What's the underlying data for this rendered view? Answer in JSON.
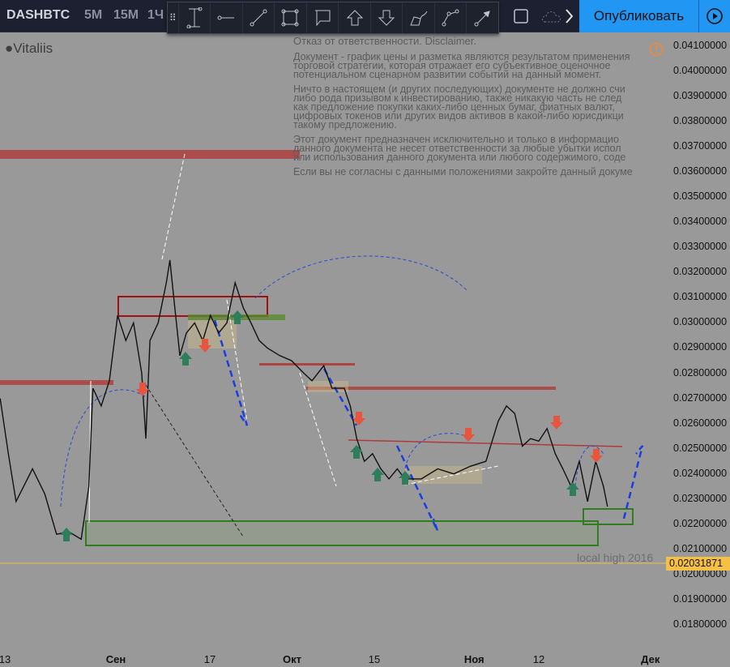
{
  "header": {
    "symbol": "DASHBTC",
    "intervals": [
      "5М",
      "15М",
      "1Ч"
    ],
    "publish_label": "Опубликовать"
  },
  "drawing_tools": [
    "cross-line-icon",
    "horizontal-ray-icon",
    "trend-line-icon",
    "rectangle-icon",
    "callout-icon",
    "arrow-up-icon",
    "arrow-down-icon",
    "brush-icon",
    "path-icon",
    "arrow-line-icon"
  ],
  "author": "Vitaliis",
  "disclaimer": {
    "title": "Отказ от ответственности. Disclaimer.",
    "p1": [
      "Документ - график цены и разметка являются результатом применения",
      "торговой стратегии, которая отражает его субъективное оценочное",
      "потенциальном сценарном развитии событий на данный момент."
    ],
    "p2": [
      "Ничто в настоящем (и других последующих) документе не должно счи",
      "либо рода призывом к инвестированию, также никакую часть не след",
      "как предложение покупки каких-либо ценных бумаг, фиатных валют,",
      "цифровых токенов или других видов активов в какой-либо юрисдикци",
      "такому предложению."
    ],
    "p3": [
      "Этот документ предназначен исключительно и только в информацио",
      "данного документа не несет ответственности за любые убытки испол",
      "или использования данного документа или любого содержимого, соде"
    ],
    "p4": "Если вы не согласны с данными положениями закройте данный докуме"
  },
  "colors": {
    "bg": "#999999",
    "publish": "#2196f3",
    "last_price": "#f5c044",
    "resistance": "#b03a3a",
    "support": "#3f8a2f",
    "forecast": "#1a3ee0"
  },
  "chart_data": {
    "type": "line",
    "title": "DASHBTC",
    "ylim": [
      0.0175,
      0.0415
    ],
    "yticks": [
      "0.04100000",
      "0.04000000",
      "0.03900000",
      "0.03800000",
      "0.03700000",
      "0.03600000",
      "0.03500000",
      "0.03400000",
      "0.03300000",
      "0.03200000",
      "0.03100000",
      "0.03000000",
      "0.02900000",
      "0.02800000",
      "0.02700000",
      "0.02600000",
      "0.02500000",
      "0.02400000",
      "0.02300000",
      "0.02200000",
      "0.02100000",
      "0.02000000",
      "0.01900000",
      "0.01800000"
    ],
    "xticks": [
      {
        "label": "13",
        "day": -19,
        "bold": false
      },
      {
        "label": "Сен",
        "day": 0,
        "bold": true
      },
      {
        "label": "17",
        "day": 16,
        "bold": false
      },
      {
        "label": "Окт",
        "day": 30,
        "bold": true
      },
      {
        "label": "15",
        "day": 44,
        "bold": false
      },
      {
        "label": "Ноя",
        "day": 61,
        "bold": true
      },
      {
        "label": "12",
        "day": 72,
        "bold": false
      },
      {
        "label": "Дек",
        "day": 91,
        "bold": true
      }
    ],
    "xunit": "days since Sep 1",
    "series": [
      {
        "name": "DASHBTC",
        "points": [
          [
            -19.7,
            0.027
          ],
          [
            -18.3,
            0.0248
          ],
          [
            -17,
            0.0229
          ],
          [
            -14.2,
            0.0242
          ],
          [
            -12.1,
            0.0232
          ],
          [
            -10.1,
            0.0216
          ],
          [
            -8,
            0.0217
          ],
          [
            -5.9,
            0.0214
          ],
          [
            -4.6,
            0.0235
          ],
          [
            -3.9,
            0.0274
          ],
          [
            -2.5,
            0.0267
          ],
          [
            -1.1,
            0.0277
          ],
          [
            0.3,
            0.0303
          ],
          [
            1.7,
            0.0293
          ],
          [
            3,
            0.03
          ],
          [
            4.4,
            0.028
          ],
          [
            5.1,
            0.0254
          ],
          [
            5.8,
            0.0293
          ],
          [
            7.2,
            0.03
          ],
          [
            8.6,
            0.0316
          ],
          [
            9.2,
            0.0325
          ],
          [
            9.9,
            0.0309
          ],
          [
            10.9,
            0.0287
          ],
          [
            12,
            0.0296
          ],
          [
            13.4,
            0.03
          ],
          [
            14.8,
            0.0293
          ],
          [
            16.1,
            0.0303
          ],
          [
            17.5,
            0.0296
          ],
          [
            18.9,
            0.03
          ],
          [
            20.3,
            0.0316
          ],
          [
            21.7,
            0.0306
          ],
          [
            23,
            0.03
          ],
          [
            24.4,
            0.0293
          ],
          [
            25.8,
            0.029
          ],
          [
            27.9,
            0.0287
          ],
          [
            29.9,
            0.0285
          ],
          [
            32,
            0.028
          ],
          [
            33.4,
            0.0277
          ],
          [
            35.4,
            0.0283
          ],
          [
            36.8,
            0.0274
          ],
          [
            38.9,
            0.0274
          ],
          [
            39.9,
            0.0267
          ],
          [
            41,
            0.0254
          ],
          [
            42.3,
            0.0245
          ],
          [
            43.7,
            0.0248
          ],
          [
            45.1,
            0.0242
          ],
          [
            46.5,
            0.0238
          ],
          [
            47.9,
            0.0242
          ],
          [
            49.2,
            0.0238
          ],
          [
            52,
            0.0238
          ],
          [
            54.8,
            0.0242
          ],
          [
            57.5,
            0.024
          ],
          [
            60.3,
            0.0243
          ],
          [
            63,
            0.0245
          ],
          [
            65.1,
            0.0261
          ],
          [
            66.5,
            0.0267
          ],
          [
            67.9,
            0.0264
          ],
          [
            69.2,
            0.0251
          ],
          [
            70.6,
            0.0254
          ],
          [
            72,
            0.0253
          ],
          [
            73.4,
            0.0258
          ],
          [
            74.8,
            0.0248
          ],
          [
            76.1,
            0.0242
          ],
          [
            77.5,
            0.0235
          ],
          [
            78.9,
            0.0245
          ],
          [
            80.3,
            0.0229
          ],
          [
            81.7,
            0.0245
          ],
          [
            83,
            0.0235
          ],
          [
            83.7,
            0.0227
          ]
        ]
      }
    ],
    "last_price": "0.02031871",
    "annotations": [
      "local high 2016"
    ]
  }
}
